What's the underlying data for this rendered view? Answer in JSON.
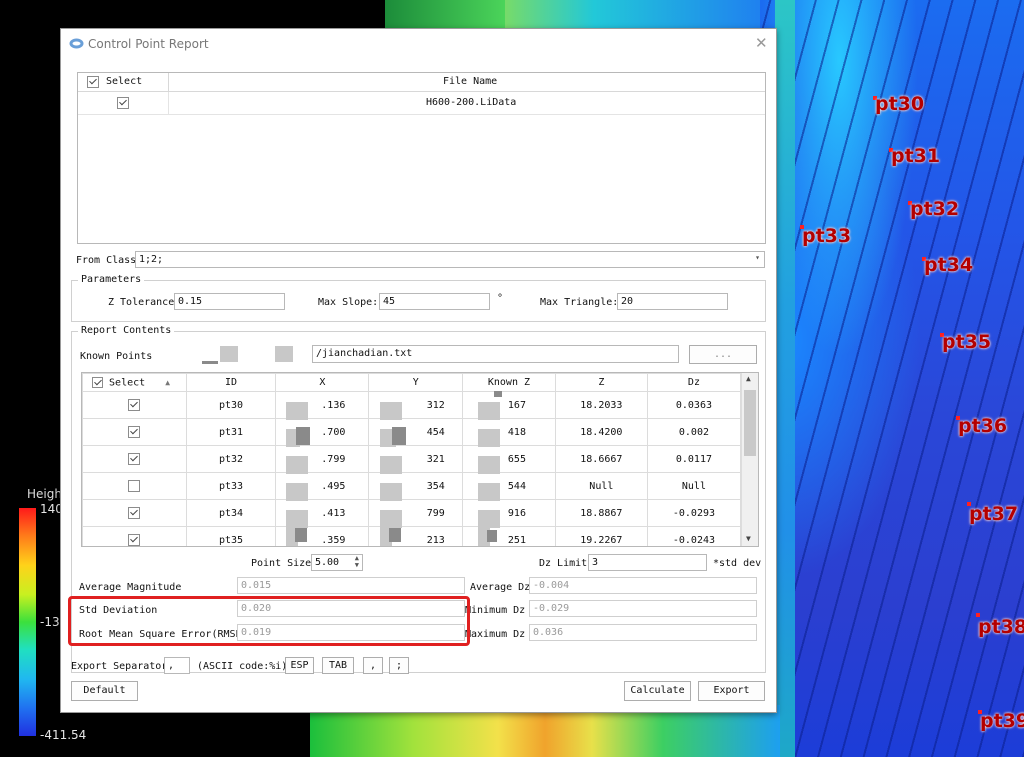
{
  "background": {
    "point_labels": [
      "pt30",
      "pt31",
      "pt32",
      "pt33",
      "pt34",
      "pt35",
      "pt36",
      "pt37",
      "pt38",
      "pt39"
    ],
    "legend": {
      "title": "Heigh",
      "max": "140",
      "mid": "-13",
      "min": "-411.54"
    }
  },
  "dialog": {
    "title": "Control Point Report",
    "files": {
      "header_select": "Select",
      "header_file": "File Name",
      "rows": [
        {
          "checked": true,
          "file": "H600-200.LiData"
        }
      ]
    },
    "from_class": {
      "label": "From Class:",
      "value": "1;2;"
    },
    "parameters": {
      "title": "Parameters",
      "z_tolerance_label": "Z Tolerance",
      "z_tolerance": "0.15",
      "max_slope_label": "Max Slope:",
      "max_slope": "45",
      "degree": "°",
      "max_triangle_label": "Max Triangle:",
      "max_triangle": "20"
    },
    "report": {
      "title": "Report Contents",
      "known_points_label": "Known Points",
      "known_points_path": "/jianchadian.txt",
      "browse_label": "...",
      "columns": [
        "Select",
        "ID",
        "X",
        "Y",
        "Known Z",
        "Z",
        "Dz"
      ],
      "rows": [
        {
          "checked": true,
          "id": "pt30",
          "x": ".136",
          "y": "312",
          "kz": "167",
          "z": "18.2033",
          "dz": "0.0363"
        },
        {
          "checked": true,
          "id": "pt31",
          "x": ".700",
          "y": "454",
          "kz": "418",
          "z": "18.4200",
          "dz": "0.002"
        },
        {
          "checked": true,
          "id": "pt32",
          "x": ".799",
          "y": "321",
          "kz": "655",
          "z": "18.6667",
          "dz": "0.0117"
        },
        {
          "checked": false,
          "id": "pt33",
          "x": ".495",
          "y": "354",
          "kz": "544",
          "z": "Null",
          "dz": "Null"
        },
        {
          "checked": true,
          "id": "pt34",
          "x": ".413",
          "y": "799",
          "kz": "916",
          "z": "18.8867",
          "dz": "-0.0293"
        },
        {
          "checked": true,
          "id": "pt35",
          "x": ".359",
          "y": "213",
          "kz": "251",
          "z": "19.2267",
          "dz": "-0.0243"
        }
      ],
      "point_size_label": "Point Size",
      "point_size": "5.00",
      "dz_limit_label": "Dz Limit",
      "dz_limit": "3",
      "std_dev_suffix": "*std dev"
    },
    "stats": {
      "avg_magnitude_label": "Average Magnitude",
      "avg_magnitude": "0.015",
      "std_dev_label": "Std Deviation",
      "std_dev": "0.020",
      "rmse_label": "Root Mean Square Error(RMSE)",
      "rmse": "0.019",
      "avg_dz_label": "Average Dz",
      "avg_dz": "-0.004",
      "min_dz_label": "Minimum Dz",
      "min_dz": "-0.029",
      "max_dz_label": "Maximum Dz",
      "max_dz": "0.036"
    },
    "export": {
      "separator_label": "Export Separator",
      "separator_value": ",",
      "ascii_label": "(ASCII code:%i)",
      "esp": "ESP",
      "tab": "TAB",
      "comma": ",",
      "semicolon": ";"
    },
    "buttons": {
      "default": "Default",
      "calculate": "Calculate",
      "export": "Export"
    }
  }
}
